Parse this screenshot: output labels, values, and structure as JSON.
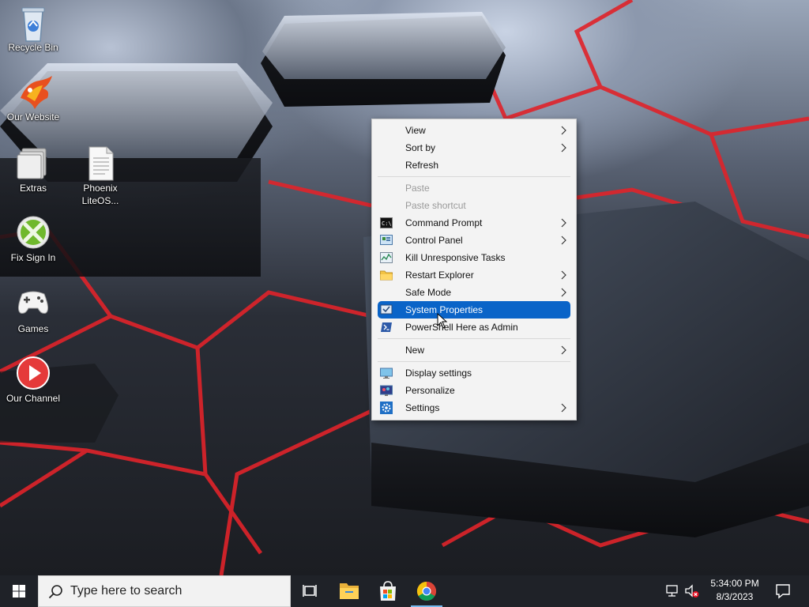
{
  "desktop": {
    "icons": [
      {
        "label": "Recycle Bin",
        "icon": "recycle-bin-icon"
      },
      {
        "label": "Our Website",
        "icon": "phoenix-bird-icon"
      },
      {
        "label": "Extras",
        "icon": "folder-stack-icon"
      },
      {
        "label": "Phoenix LiteOS...",
        "icon": "text-file-icon"
      },
      {
        "label": "Fix Sign In",
        "icon": "xbox-icon"
      },
      {
        "label": "Games",
        "icon": "gamepad-icon"
      },
      {
        "label": "Our Channel",
        "icon": "play-button-icon"
      }
    ]
  },
  "context_menu": {
    "items": [
      {
        "label": "View",
        "submenu": true
      },
      {
        "label": "Sort by",
        "submenu": true
      },
      {
        "label": "Refresh"
      },
      {
        "label": "Paste",
        "disabled": true
      },
      {
        "label": "Paste shortcut",
        "disabled": true
      },
      {
        "label": "Command Prompt",
        "submenu": true,
        "icon": "terminal-icon"
      },
      {
        "label": "Control Panel",
        "submenu": true,
        "icon": "control-panel-icon"
      },
      {
        "label": "Kill Unresponsive Tasks",
        "icon": "task-manager-icon"
      },
      {
        "label": "Restart Explorer",
        "submenu": true,
        "icon": "folder-icon"
      },
      {
        "label": "Safe Mode",
        "submenu": true
      },
      {
        "label": "System Properties",
        "highlighted": true,
        "icon": "system-properties-icon"
      },
      {
        "label": "PowerShell Here as Admin",
        "icon": "powershell-icon"
      },
      {
        "label": "New",
        "submenu": true
      },
      {
        "label": "Display settings",
        "icon": "display-icon"
      },
      {
        "label": "Personalize",
        "icon": "personalize-icon"
      },
      {
        "label": "Settings",
        "submenu": true,
        "icon": "settings-gear-icon"
      }
    ]
  },
  "taskbar": {
    "search_placeholder": "Type here to search",
    "clock_time": "5:34:00 PM",
    "clock_date": "8/3/2023",
    "pinned": [
      "task-view-icon",
      "file-explorer-icon",
      "microsoft-store-icon",
      "chrome-icon"
    ]
  },
  "colors": {
    "highlight": "#0a64c8",
    "taskbar": "#1f2228",
    "wallpaper_accent": "#e0232a"
  }
}
